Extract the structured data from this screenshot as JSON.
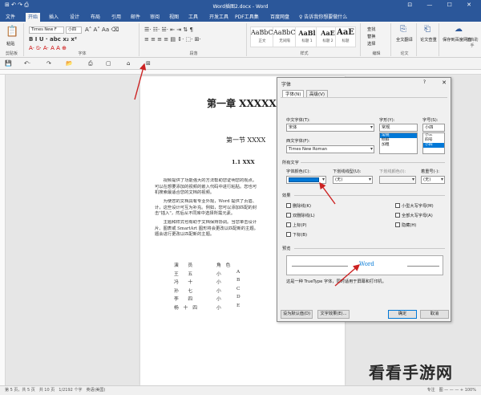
{
  "window": {
    "title": "Word插图2.docx - Word",
    "controls": "⊡ — ☐ ✕",
    "quick_access": "⊞ ↶ ↷ ⎙"
  },
  "ribbon_tabs": [
    "文件",
    "开始",
    "插入",
    "设计",
    "布局",
    "引用",
    "邮件",
    "审阅",
    "视图",
    "工具",
    "开发工具",
    "PDF工具集",
    "百度网盘",
    "♀ 告诉我你想要做什么"
  ],
  "ribbon": {
    "paste_label": "粘贴",
    "clipboard_label": "剪贴板",
    "font_name": "Times New F",
    "font_size": "小四",
    "font_group_label": "字体",
    "paragraph_group_label": "段落",
    "styles_group_label": "样式",
    "editing_group_label": "编辑",
    "styles": [
      {
        "sample": "AaBbCc",
        "name": "正文"
      },
      {
        "sample": "AaBbCc",
        "name": "无间隔"
      },
      {
        "sample": "AaBl",
        "name": "标题 1"
      },
      {
        "sample": "AaE",
        "name": "标题 2"
      },
      {
        "sample": "AaE",
        "name": "标题"
      }
    ],
    "find": "查找",
    "replace": "替换",
    "select": "选择",
    "save_baidu": "保存到百度网盘",
    "extra_labels": [
      "全文翻译",
      "论文查重",
      "文档助手",
      "论文"
    ]
  },
  "document": {
    "chapter_title": "第一章 XXXXX",
    "section_title": "第一节 XXXX",
    "subsection_title": "1.1 XXX",
    "para1": [
      "　　视频提供了功能强大的方法帮助您证明您的观点。",
      "可以在想要添加的视频的嵌入代码中进行粘贴。您也可",
      "机搜索最适合您的文档的视频。"
    ],
    "para2_lines": [
      "　　为使您的文档具有专业外观，Word 提供了页眉、",
      "计，这些设计可互为补充。例如，您可以添加匹配的封",
      "击\"插入\"，然后从不同库中选择所需元素。"
    ],
    "para3_lines": [
      "　　主题和样式也有助于文档保持协调。当您单击设计",
      "片、图表或 SmartArt 图形将会更改以匹配新的主题。",
      "题会进行更改以匹配新的主题。"
    ],
    "word_red": "Word",
    "smartart_red": "SmartArt",
    "table_header": [
      "演　员",
      "角　色"
    ],
    "table_rows": [
      [
        "演　　员",
        "角　色",
        ""
      ],
      [
        "王　　五",
        "小",
        "A"
      ],
      [
        "冯　　十",
        "小",
        "B"
      ],
      [
        "孙　　七",
        "小",
        "C"
      ],
      [
        "李　　四",
        "小",
        "D"
      ],
      [
        "杨　十　四",
        "小",
        "E"
      ]
    ]
  },
  "font_dialog": {
    "title": "字体",
    "help": "?",
    "close": "✕",
    "tabs": [
      "字体(N)",
      "高级(V)"
    ],
    "chinese_font_label": "中文字体(T):",
    "chinese_font_value": "宋体",
    "western_font_label": "西文字体(F):",
    "western_font_value": "Times New Roman",
    "style_label": "字形(Y):",
    "style_value": "常规",
    "style_options": [
      "常规",
      "倾斜",
      "加粗"
    ],
    "size_label": "字号(S):",
    "size_value": "小四",
    "size_options": [
      "小三",
      "四号",
      "小四"
    ],
    "all_text_label": "所有文字",
    "font_color_label": "字体颜色(C):",
    "underline_label": "下划线线型(U):",
    "underline_value": "(无)",
    "underline_color_label": "下划线颜色(I):",
    "emphasis_label": "着重号(·):",
    "emphasis_value": "(无)",
    "effects_label": "效果",
    "effects": [
      {
        "label": "删除线(K)",
        "checked": false
      },
      {
        "label": "双删除线(L)",
        "checked": false
      },
      {
        "label": "上标(P)",
        "checked": false
      },
      {
        "label": "下标(B)",
        "checked": false
      },
      {
        "label": "小型大写字母(M)",
        "checked": false
      },
      {
        "label": "全部大写字母(A)",
        "checked": false
      },
      {
        "label": "隐藏(H)",
        "checked": false
      }
    ],
    "preview_label": "预览",
    "preview_text": "Word",
    "note": "这是一种 TrueType 字体，同时适用于屏幕和打印机。",
    "set_default": "设为默认值(D)",
    "text_effects": "文字效果(E)...",
    "ok": "确定",
    "cancel": "取消"
  },
  "status": {
    "left": "第 5 页，共 5 页　共 10 页　1/2192 个字　英语(美国)",
    "right": "专注　图 — — — + 100%"
  },
  "watermark": "看看手游网",
  "colors": {
    "brand": "#2b579a",
    "arrow": "#cc2222",
    "accent": "#0078d7"
  }
}
